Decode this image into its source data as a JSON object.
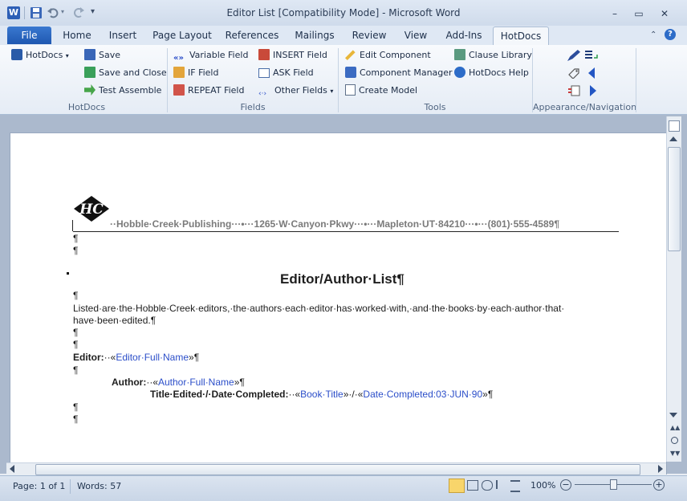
{
  "window": {
    "title": "Editor List [Compatibility Mode] - Microsoft Word",
    "controls": {
      "minimize": "–",
      "restore": "▭",
      "close": "✕"
    }
  },
  "tabs": [
    {
      "label": "File"
    },
    {
      "label": "Home"
    },
    {
      "label": "Insert"
    },
    {
      "label": "Page Layout"
    },
    {
      "label": "References"
    },
    {
      "label": "Mailings"
    },
    {
      "label": "Review"
    },
    {
      "label": "View"
    },
    {
      "label": "Add-Ins"
    },
    {
      "label": "HotDocs"
    }
  ],
  "ribbon": {
    "groups": {
      "hotdocs": "HotDocs",
      "fields": "Fields",
      "tools": "Tools",
      "appearance": "Appearance/Navigation"
    },
    "hotdocs_menu": "HotDocs",
    "save": "Save",
    "save_close": "Save and Close",
    "test_assemble": "Test Assemble",
    "variable_field": "Variable Field",
    "if_field": "IF Field",
    "repeat_field": "REPEAT Field",
    "insert_field": "INSERT Field",
    "ask_field": "ASK Field",
    "other_fields": "Other Fields",
    "edit_component": "Edit Component",
    "component_manager": "Component Manager",
    "create_model": "Create Model",
    "clause_library": "Clause Library",
    "hotdocs_help": "HotDocs Help"
  },
  "document": {
    "logo_text": "HC",
    "letterhead": "··Hobble·Creek·Publishing···•···1265·W·Canyon·Pkwy···•···Mapleton·UT·84210···•···(801)·555-4589¶",
    "pilcrow": "¶",
    "heading": "Editor/Author·List¶",
    "intro_line1": "Listed·are·the·Hobble·Creek·editors,·the·authors·each·editor·has·worked·with,·and·the·books·by·each·author·that·",
    "intro_line2": "have·been·edited.¶",
    "editor_label": "Editor:",
    "editor_field": "«Editor·Full·Name»",
    "author_label": "Author:",
    "author_field": "«Author·Full·Name»",
    "title_label": "Title·Edited·/·Date·Completed:",
    "book_field": "«Book·Title»",
    "date_sep": "·/·",
    "date_field": "«Date·Completed:03·JUN·90»"
  },
  "status": {
    "page": "Page: 1 of 1",
    "words": "Words: 57",
    "zoom": "100%"
  }
}
